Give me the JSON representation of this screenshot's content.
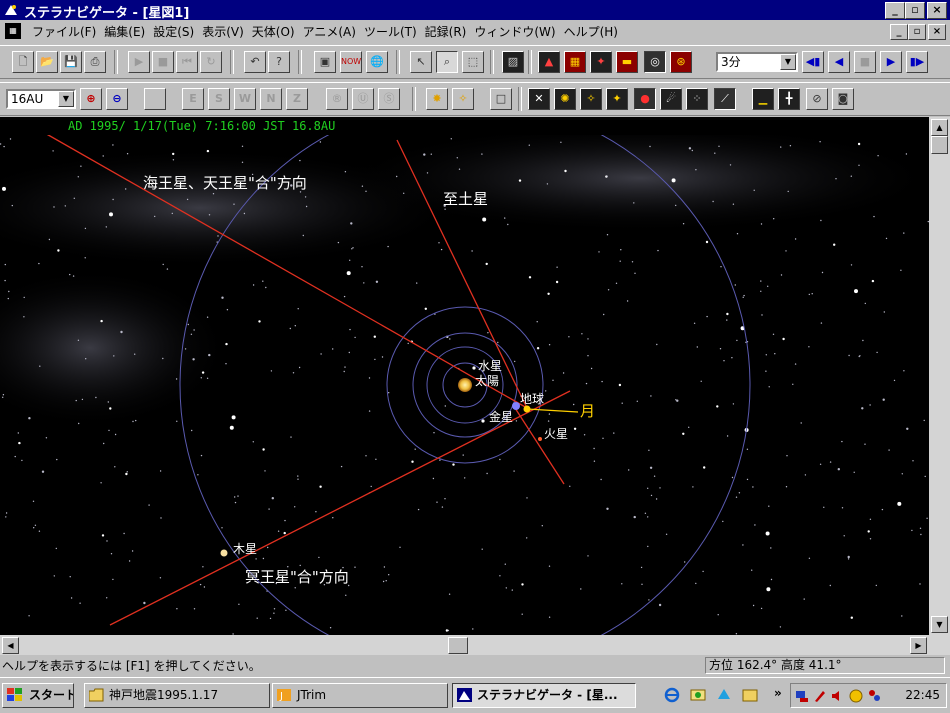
{
  "window": {
    "title": "ステラナビゲータ - [星図1]",
    "minimize": "_",
    "maximize": "▫",
    "close": "×"
  },
  "menu": {
    "items": [
      "ファイル(F)",
      "編集(E)",
      "設定(S)",
      "表示(V)",
      "天体(O)",
      "アニメ(A)",
      "ツール(T)",
      "記録(R)",
      "ウィンドウ(W)",
      "ヘルプ(H)"
    ]
  },
  "toolbar1": {
    "speed_select": "3分"
  },
  "toolbar2": {
    "scale_select": "16AU",
    "directions": [
      "E",
      "S",
      "W",
      "N",
      "Z"
    ]
  },
  "sky": {
    "info": "AD 1995/ 1/17(Tue)  7:16:00 JST  16.8AU",
    "labels": {
      "neptune_uranus_direction": "海王星、天王星\"合\"方向",
      "saturn": "至土星",
      "mercury": "水星",
      "sun": "太陽",
      "earth": "地球",
      "moon": "月",
      "venus": "金星",
      "mars": "火星",
      "jupiter": "木星",
      "pluto_direction": "冥王星\"合\"方向"
    }
  },
  "status": {
    "help": "ヘルプを表示するには [F1] を押してください。",
    "coords": "方位 162.4° 高度  41.1°"
  },
  "taskbar": {
    "start": "スタート",
    "tasks": [
      "神戸地震1995.1.17",
      "JTrim",
      "ステラナビゲータ - [星..."
    ],
    "more": "»",
    "clock": "22:45"
  },
  "colors": {
    "title_bg": "#000080",
    "sky_bg": "#000000",
    "info_text": "#20d020",
    "orbit": "#5a5ab0",
    "direction_line": "#e03020",
    "moon_label": "#ffd000"
  }
}
